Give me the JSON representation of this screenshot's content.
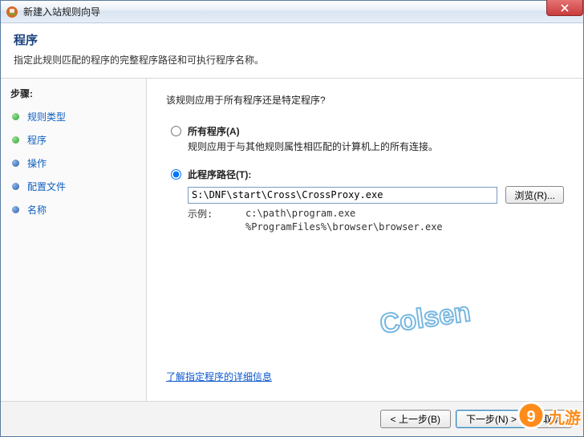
{
  "window": {
    "title": "新建入站规则向导"
  },
  "header": {
    "title": "程序",
    "subtitle": "指定此规则匹配的程序的完整程序路径和可执行程序名称。"
  },
  "sidebar": {
    "title": "步骤:",
    "items": [
      {
        "label": "规则类型",
        "state": "done"
      },
      {
        "label": "程序",
        "state": "current"
      },
      {
        "label": "操作",
        "state": "pending"
      },
      {
        "label": "配置文件",
        "state": "pending"
      },
      {
        "label": "名称",
        "state": "pending"
      }
    ]
  },
  "main": {
    "question": "该规则应用于所有程序还是特定程序?",
    "option_all": {
      "label": "所有程序(A)",
      "desc": "规则应用于与其他规则属性相匹配的计算机上的所有连接。",
      "selected": false
    },
    "option_path": {
      "label": "此程序路径(T):",
      "selected": true,
      "value": "S:\\DNF\\start\\Cross\\CrossProxy.exe",
      "browse": "浏览(R)...",
      "example_label": "示例:",
      "example_paths": "c:\\path\\program.exe\n%ProgramFiles%\\browser\\browser.exe"
    },
    "link": "了解指定程序的详细信息"
  },
  "footer": {
    "back": "< 上一步(B)",
    "next": "下一步(N) >",
    "cancel": "取消"
  },
  "watermark": "Colsen",
  "corner_brand": "九游"
}
